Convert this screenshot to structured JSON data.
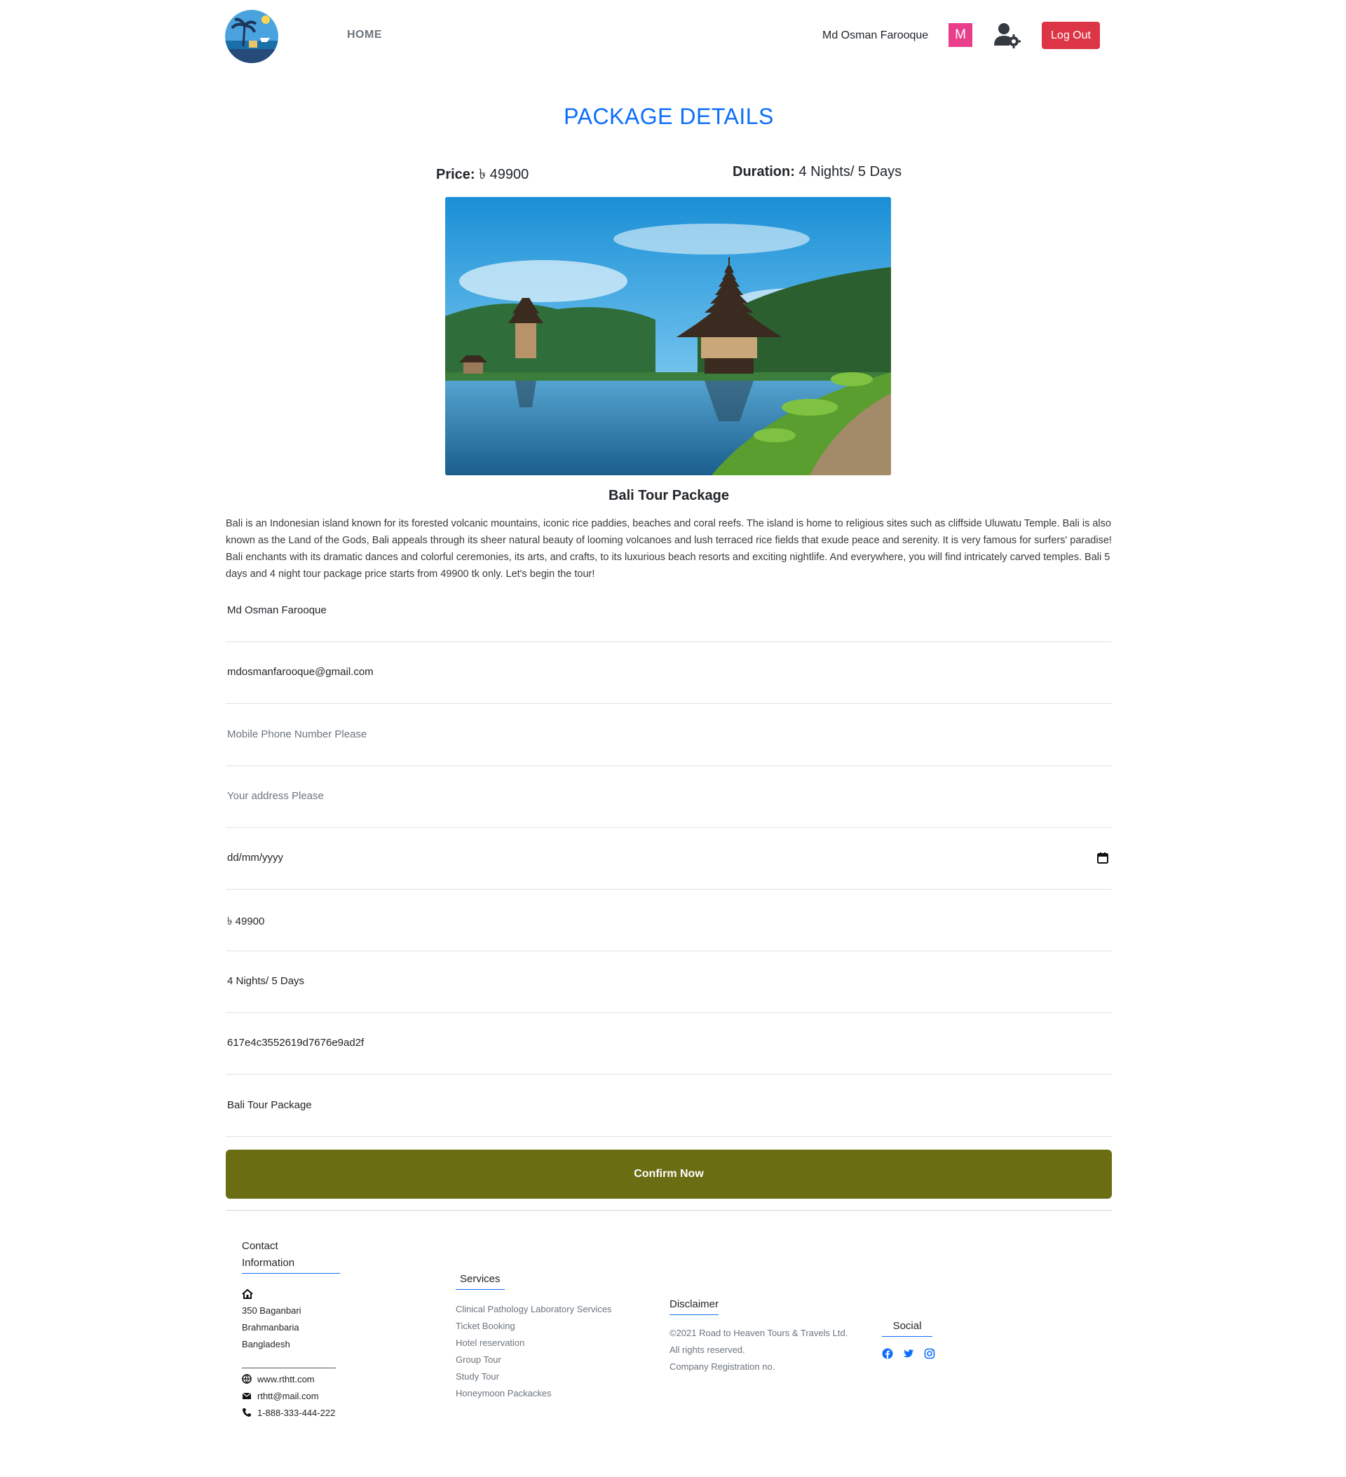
{
  "header": {
    "nav_home": "HOME",
    "user_name": "Md Osman Farooque",
    "avatar_letter": "M",
    "logout_label": "Log Out"
  },
  "page": {
    "title": "PACKAGE DETAILS",
    "price_label": "Price:",
    "price_value": "৳ 49900",
    "duration_label": "Duration:",
    "duration_value": "4 Nights/ 5 Days",
    "package_name": "Bali Tour Package",
    "description": "Bali is an Indonesian island known for its forested volcanic mountains, iconic rice paddies, beaches and coral reefs. The island is home to religious sites such as cliffside Uluwatu Temple. Bali is also known as the Land of the Gods, Bali appeals through its sheer natural beauty of looming volcanoes and lush terraced rice fields that exude peace and serenity. It is very famous for surfers' paradise! Bali enchants with its dramatic dances and colorful ceremonies, its arts, and crafts, to its luxurious beach resorts and exciting nightlife. And everywhere, you will find intricately carved temples. Bali 5 days and 4 night tour package price starts from 49900 tk only. Let's begin the tour!"
  },
  "form": {
    "name_value": "Md Osman Farooque",
    "email_value": "mdosmanfarooque@gmail.com",
    "phone_placeholder": "Mobile Phone Number Please",
    "address_placeholder": "Your address Please",
    "date_placeholder": "dd/mm/yyyy",
    "price_value": "৳ 49900",
    "duration_value": "4 Nights/ 5 Days",
    "package_id_value": "617e4c3552619d7676e9ad2f",
    "package_name_value": "Bali Tour Package",
    "confirm_label": "Confirm Now"
  },
  "footer": {
    "contact_heading_line1": "Contact",
    "contact_heading_line2": "Information",
    "address_line1": "350 Baganbari",
    "address_line2": "Brahmanbaria",
    "address_line3": "Bangladesh",
    "website": "www.rthtt.com",
    "email": "rthtt@mail.com",
    "phone": "1-888-333-444-222",
    "services_heading": "Services",
    "services": [
      "Clinical Pathology Laboratory Services",
      "Ticket Booking",
      "Hotel reservation",
      "Group Tour",
      "Study Tour",
      "Honeymoon Packackes"
    ],
    "disclaimer_heading": "Disclaimer",
    "disclaimer_line1": "©2021 Road to Heaven Tours & Travels Ltd.",
    "disclaimer_line2": "All rights reserved.",
    "disclaimer_line3": "Company Registration no.",
    "social_heading": "Social",
    "social_icons": [
      "facebook-icon",
      "twitter-icon",
      "instagram-icon"
    ]
  },
  "colors": {
    "title_blue": "#0d6efd",
    "logout_red": "#dc3545",
    "avatar_pink": "#e83e8c",
    "confirm_olive": "#6a6d12"
  }
}
